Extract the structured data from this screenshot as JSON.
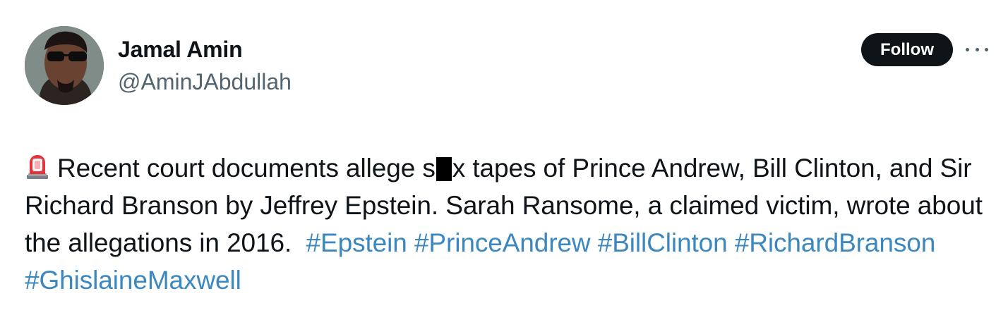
{
  "author": {
    "display_name": "Jamal Amin",
    "handle": "@AminJAbdullah"
  },
  "actions": {
    "follow_label": "Follow"
  },
  "tweet": {
    "icon": "rotating-light-icon",
    "text_part_1": "Recent court documents allege s",
    "text_part_2": "x tapes of Prince Andrew, Bill Clinton, and Sir Richard Branson by Jeffrey Epstein. Sarah Ransome, a claimed victim, wrote about the allegations in 2016.",
    "hashtags": [
      "#Epstein",
      "#PrinceAndrew",
      "#BillClinton",
      "#RichardBranson",
      "#GhislaineMaxwell"
    ]
  },
  "colors": {
    "hashtag": "#3b87bf",
    "follow_bg": "#0f1419",
    "secondary_text": "#536471"
  }
}
